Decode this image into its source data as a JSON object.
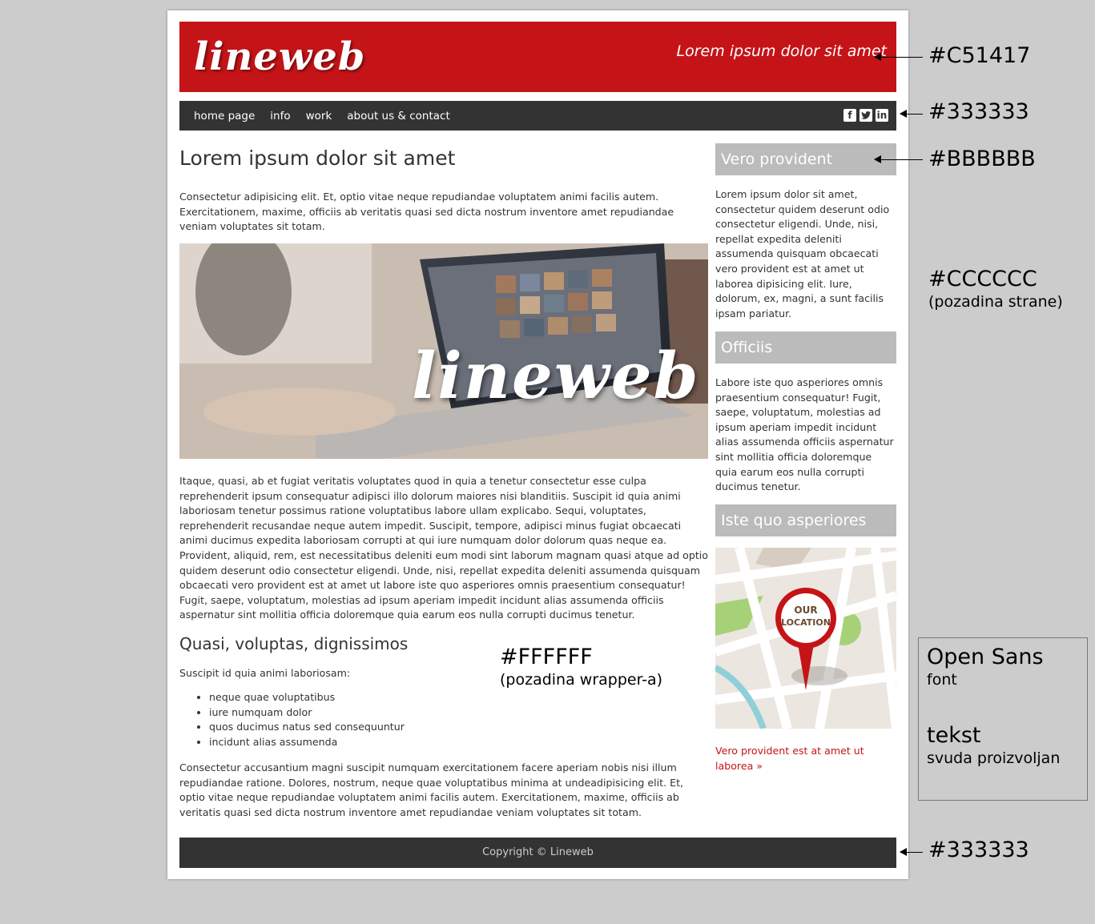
{
  "header": {
    "logo": "lineweb",
    "tagline": "Lorem ipsum dolor sit amet"
  },
  "nav": {
    "items": [
      "home page",
      "info",
      "work",
      "about us & contact"
    ],
    "social": [
      "facebook-icon",
      "twitter-icon",
      "linkedin-icon"
    ]
  },
  "main": {
    "title": "Lorem ipsum dolor sit amet",
    "intro": "Consectetur adipisicing elit. Et, optio vitae neque repudiandae voluptatem animi facilis autem. Exercitationem, maxime, officiis ab veritatis quasi sed dicta nostrum inventore amet repudiandae veniam voluptates sit totam.",
    "hero_overlay": "lineweb",
    "body": "Itaque, quasi, ab et fugiat veritatis voluptates quod in quia a tenetur consectetur esse culpa reprehenderit ipsum consequatur adipisci illo dolorum maiores nisi blanditiis. Suscipit id quia animi laboriosam tenetur possimus ratione voluptatibus labore ullam explicabo. Sequi, voluptates, reprehenderit recusandae neque autem impedit. Suscipit, tempore, adipisci minus fugiat obcaecati animi ducimus expedita laboriosam corrupti at qui iure numquam dolor dolorum quas neque ea. Provident, aliquid, rem, est necessitatibus deleniti eum modi sint laborum magnam quasi atque ad optio quidem deserunt odio consectetur eligendi. Unde, nisi, repellat expedita deleniti assumenda quisquam obcaecati vero provident est at amet ut labore iste quo asperiores omnis praesentium consequatur! Fugit, saepe, voluptatum, molestias ad ipsum aperiam impedit incidunt alias assumenda officiis aspernatur sint mollitia officia doloremque quia earum eos nulla corrupti ducimus tenetur.",
    "subtitle": "Quasi, voluptas, dignissimos",
    "lead": "Suscipit id quia animi laboriosam:",
    "list": [
      "neque quae voluptatibus",
      "iure numquam dolor",
      "quos ducimus natus sed consequuntur",
      "incidunt alias assumenda"
    ],
    "outro": "Consectetur accusantium magni suscipit numquam exercitationem facere aperiam nobis nisi illum repudiandae ratione. Dolores, nostrum, neque quae voluptatibus minima at undeadipisicing elit. Et, optio vitae neque repudiandae voluptatem animi facilis autem. Exercitationem, maxime, officiis ab veritatis quasi sed dicta nostrum inventore amet repudiandae veniam voluptates sit totam."
  },
  "sidebar": {
    "box1_title": "Vero provident",
    "box1_text": "Lorem ipsum dolor sit amet, consectetur quidem deserunt odio consectetur eligendi. Unde, nisi, repellat expedita deleniti assumenda quisquam obcaecati vero provident est at amet ut laborea dipisicing elit. Iure, dolorum, ex, magni, a sunt facilis ipsam pariatur.",
    "box2_title": "Officiis",
    "box2_text": "Labore iste quo asperiores omnis praesentium consequatur! Fugit, saepe, voluptatum, molestias ad ipsum aperiam impedit incidunt alias assumenda officiis aspernatur sint mollitia officia doloremque quia earum eos nulla corrupti ducimus tenetur.",
    "box3_title": "Iste quo asperiores",
    "map_pin_line1": "OUR",
    "map_pin_line2": "LOCATION",
    "link": "Vero provident est at amet ut laborea »"
  },
  "footer": {
    "copyright": "Copyright © Lineweb"
  },
  "annotations": {
    "header_color": "#C51417",
    "nav_color": "#333333",
    "sidebar_title_color": "#BBBBBB",
    "page_bg_color": "#CCCCCC",
    "page_bg_label": "(pozadina strane)",
    "wrapper_color": "#FFFFFF",
    "wrapper_label": "(pozadina wrapper-a)",
    "footer_color": "#333333",
    "font_name": "Open Sans",
    "font_word": "font",
    "text_word": "tekst",
    "text_note": "svuda proizvoljan"
  }
}
